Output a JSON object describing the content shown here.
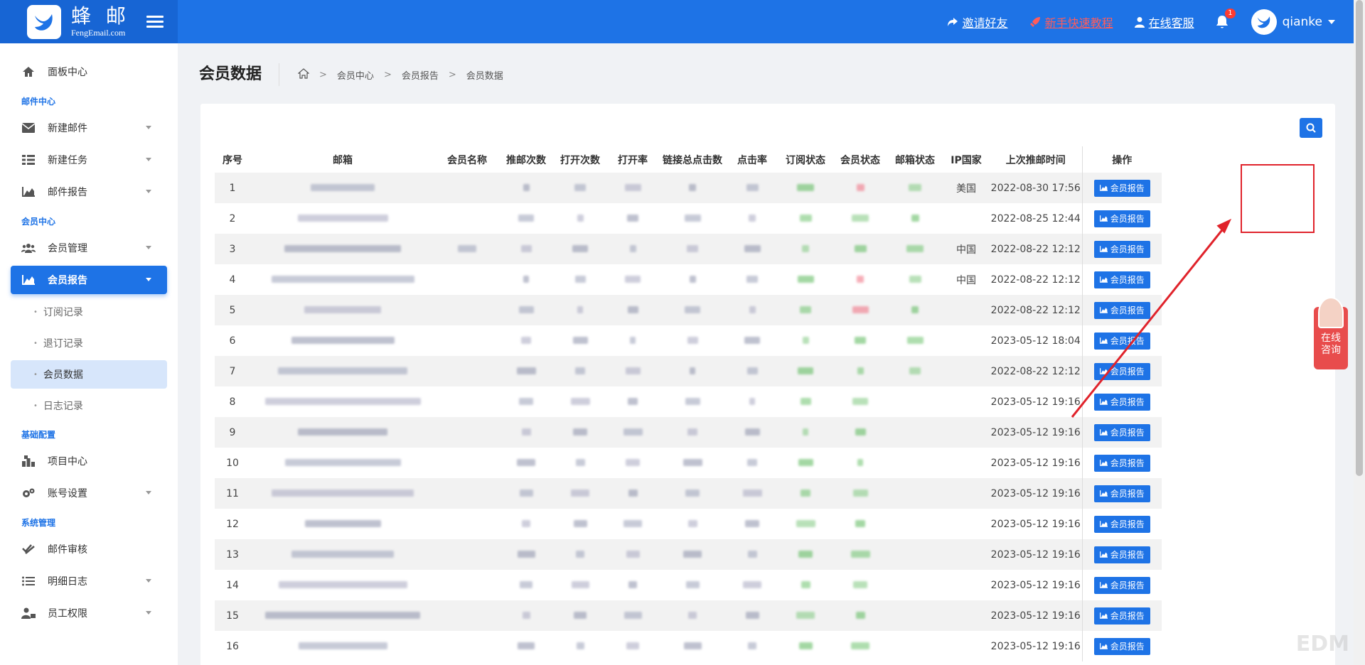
{
  "header": {
    "brand_cn": "蜂 邮",
    "brand_en": "FengEmail.com",
    "invite": "邀请好友",
    "tutorial": "新手快速教程",
    "service": "在线客服",
    "notif_count": "1",
    "username": "qianke"
  },
  "sidebar": {
    "dashboard": "面板中心",
    "group_mail": "邮件中心",
    "new_mail": "新建邮件",
    "new_task": "新建任务",
    "mail_report": "邮件报告",
    "group_member": "会员中心",
    "member_manage": "会员管理",
    "member_report": "会员报告",
    "sub": [
      "订阅记录",
      "退订记录",
      "会员数据",
      "日志记录"
    ],
    "group_base": "基础配置",
    "project": "项目中心",
    "account": "账号设置",
    "group_system": "系统管理",
    "audit": "邮件审核",
    "detail_log": "明细日志",
    "staff": "员工权限"
  },
  "page": {
    "title": "会员数据",
    "breadcrumb": [
      "会员中心",
      "会员报告",
      "会员数据"
    ]
  },
  "table": {
    "headers": [
      "序号",
      "邮箱",
      "会员名称",
      "推邮次数",
      "打开次数",
      "打开率",
      "链接总点击数",
      "点击率",
      "订阅状态",
      "会员状态",
      "邮箱状态",
      "IP国家",
      "上次推邮时间",
      "操作"
    ],
    "button_label": "会员报告",
    "rows": [
      {
        "no": "1",
        "country": "美国",
        "time": "2022-08-30 17:56"
      },
      {
        "no": "2",
        "country": "",
        "time": "2022-08-25 12:44"
      },
      {
        "no": "3",
        "country": "中国",
        "time": "2022-08-22 12:12"
      },
      {
        "no": "4",
        "country": "中国",
        "time": "2022-08-22 12:12"
      },
      {
        "no": "5",
        "country": "",
        "time": "2022-08-22 12:12"
      },
      {
        "no": "6",
        "country": "",
        "time": "2023-05-12 18:04"
      },
      {
        "no": "7",
        "country": "",
        "time": "2022-08-22 12:12"
      },
      {
        "no": "8",
        "country": "",
        "time": "2023-05-12 19:16"
      },
      {
        "no": "9",
        "country": "",
        "time": "2023-05-12 19:16"
      },
      {
        "no": "10",
        "country": "",
        "time": "2023-05-12 19:16"
      },
      {
        "no": "11",
        "country": "",
        "time": "2023-05-12 19:16"
      },
      {
        "no": "12",
        "country": "",
        "time": "2023-05-12 19:16"
      },
      {
        "no": "13",
        "country": "",
        "time": "2023-05-12 19:16"
      },
      {
        "no": "14",
        "country": "",
        "time": "2023-05-12 19:16"
      },
      {
        "no": "15",
        "country": "",
        "time": "2023-05-12 19:16"
      },
      {
        "no": "16",
        "country": "",
        "time": "2023-05-12 19:16"
      }
    ]
  },
  "float_service": {
    "line1": "在线",
    "line2": "咨询"
  },
  "watermark": "EDM",
  "colors": {
    "primary": "#1e73e6",
    "accent_red": "#e0232b"
  }
}
